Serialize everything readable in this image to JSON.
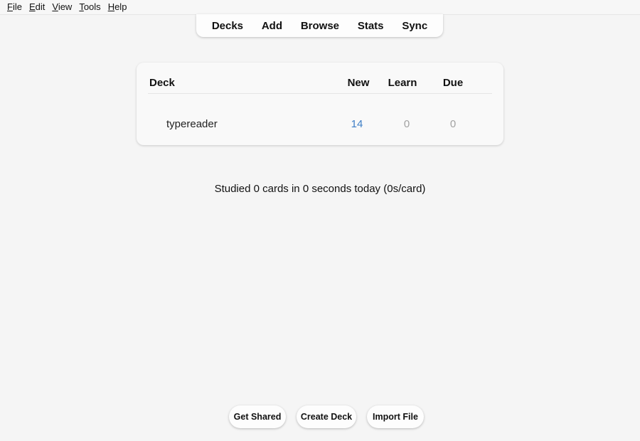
{
  "menubar": {
    "items": [
      {
        "mnemonic": "F",
        "rest": "ile"
      },
      {
        "mnemonic": "E",
        "rest": "dit"
      },
      {
        "mnemonic": "V",
        "rest": "iew"
      },
      {
        "mnemonic": "T",
        "rest": "ools"
      },
      {
        "mnemonic": "H",
        "rest": "elp"
      }
    ]
  },
  "toolbar": {
    "decks": "Decks",
    "add": "Add",
    "browse": "Browse",
    "stats": "Stats",
    "sync": "Sync"
  },
  "deck_table": {
    "headers": {
      "deck": "Deck",
      "new": "New",
      "learn": "Learn",
      "due": "Due"
    },
    "rows": [
      {
        "name": "typereader",
        "new": "14",
        "learn": "0",
        "due": "0"
      }
    ]
  },
  "colors": {
    "new_count": "#3f7fc6",
    "zero_count": "#a2a2a2"
  },
  "study_summary": "Studied 0 cards in 0 seconds today (0s/card)",
  "buttons": {
    "get_shared": "Get Shared",
    "create_deck": "Create Deck",
    "import_file": "Import File"
  }
}
